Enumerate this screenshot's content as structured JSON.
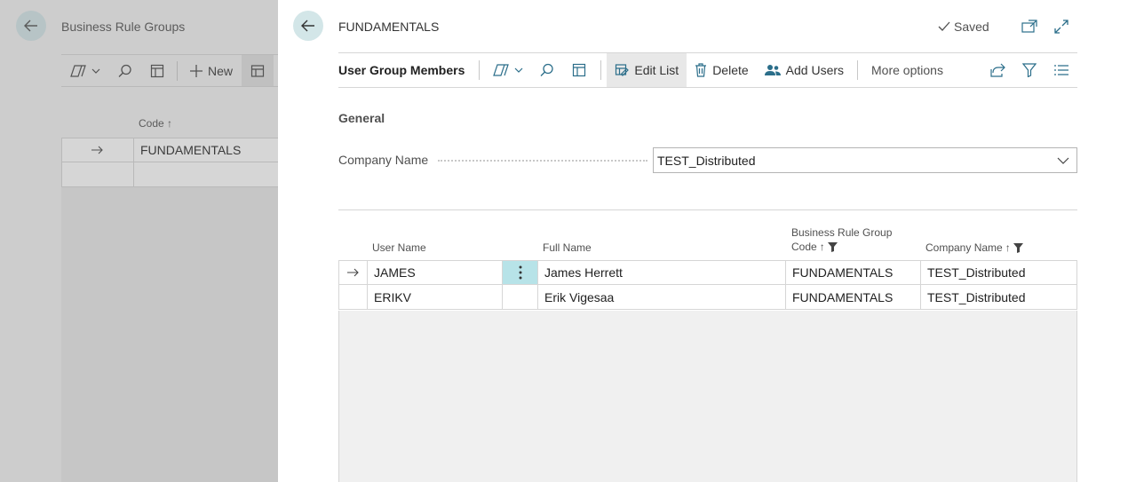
{
  "background_page": {
    "title": "Business Rule Groups",
    "toolbar": {
      "new_label": "New"
    },
    "columns": {
      "code": "Code"
    },
    "rows": [
      {
        "code": "FUNDAMENTALS"
      }
    ]
  },
  "panel": {
    "title": "FUNDAMENTALS",
    "saved_label": "Saved",
    "toolbar": {
      "title": "User Group Members",
      "edit_list_label": "Edit List",
      "delete_label": "Delete",
      "add_users_label": "Add Users",
      "more_options_label": "More options"
    },
    "section": "General",
    "company_field": {
      "label": "Company Name",
      "value": "TEST_Distributed"
    },
    "columns": {
      "user_name": "User Name",
      "full_name": "Full Name",
      "brg_code_line1": "Business Rule Group",
      "brg_code_line2": "Code",
      "company_name": "Company Name"
    },
    "rows": [
      {
        "user_name": "JAMES",
        "full_name": "James Herrett",
        "brg_code": "FUNDAMENTALS",
        "company_name": "TEST_Distributed"
      },
      {
        "user_name": "ERIKV",
        "full_name": "Erik Vigesaa",
        "brg_code": "FUNDAMENTALS",
        "company_name": "TEST_Distributed"
      }
    ]
  },
  "colors": {
    "accent_light": "#d3e6e8",
    "row_menu_active": "#b7e3e8"
  }
}
